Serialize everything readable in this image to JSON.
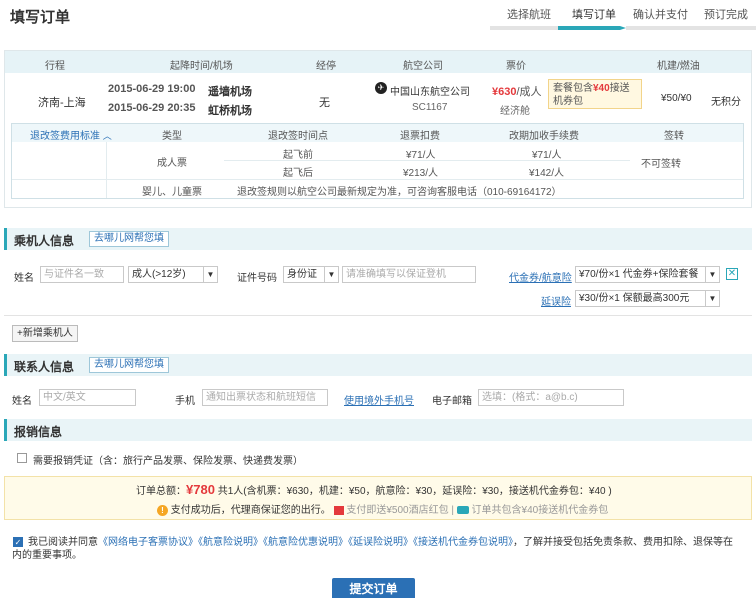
{
  "page_title": "填写订单",
  "steps": [
    {
      "label": "选择航班"
    },
    {
      "label": "填写订单"
    },
    {
      "label": "确认并支付"
    },
    {
      "label": "预订完成"
    }
  ],
  "flight_table": {
    "headers": {
      "route": "行程",
      "time_airport": "起降时间/机场",
      "stops": "经停",
      "airline": "航空公司",
      "price": "票价",
      "tax": "机建/燃油"
    },
    "route": "济南-上海",
    "dep_datetime": "2015-06-29  19:00",
    "dep_airport": "遥墙机场",
    "arr_datetime": "2015-06-29  20:35",
    "arr_airport": "虹桥机场",
    "stops": "无",
    "airline_name": "中国山东航空公司",
    "flight_no": "SC1167",
    "price": "¥630",
    "price_unit": "/成人",
    "cabin": "经济舱",
    "package_pre": "套餐包含",
    "package_amount": "¥40",
    "package_post": "接送机券包",
    "tax": "¥50/¥0",
    "points": "无积分",
    "airline_icon": "airline-logo-icon"
  },
  "rules": {
    "toggle_label": "退改签费用标准",
    "toggle_icon": "chevron-up-icon",
    "headers": {
      "type": "类型",
      "time": "退改签时间点",
      "refund": "退票扣费",
      "change": "改期加收手续费",
      "endorse": "签转"
    },
    "adult_label": "成人票",
    "rows": [
      {
        "time": "起飞前",
        "refund": "¥71/人",
        "change": "¥71/人"
      },
      {
        "time": "起飞后",
        "refund": "¥213/人",
        "change": "¥142/人"
      }
    ],
    "endorse_value": "不可签转",
    "child_label": "婴儿、儿童票",
    "child_note": "退改签规则以航空公司最新规定为准，可咨询客服电话（010-69164172）"
  },
  "passenger": {
    "title": "乘机人信息",
    "help": "去哪儿网帮您填",
    "name_label": "姓名",
    "name_placeholder": "与证件名一致",
    "type_value": "成人(>12岁)",
    "id_label": "证件号码",
    "id_type": "身份证",
    "id_placeholder": "请准确填写以保证登机",
    "insurance_link1": "代金券/航意险",
    "insurance_value1": "¥70/份×1 代金券+保险套餐",
    "insurance_link2": "延误险",
    "insurance_value2": "¥30/份×1 保额最高300元",
    "add_label": "+新增乘机人"
  },
  "contact": {
    "title": "联系人信息",
    "help": "去哪儿网帮您填",
    "name_label": "姓名",
    "name_placeholder": "中文/英文",
    "phone_label": "手机",
    "phone_placeholder": "通知出票状态和航班短信",
    "foreign_link": "使用境外手机号",
    "email_label": "电子邮箱",
    "email_placeholder": "选填：(格式：a@b.c)"
  },
  "reimburse": {
    "title": "报销信息",
    "checkbox_label": "需要报销凭证（含：旅行产品发票、保险发票、快递费发票）"
  },
  "summary": {
    "total_label": "订单总额：",
    "total_amount": "¥780",
    "total_detail": "共1人(含机票：¥630，机建：¥50，航意险：¥30，延误险：¥30，接送机代金券包：¥40 )",
    "notice": "支付成功后，代理商保证您的出行。",
    "gift_text": "支付即送¥500酒店红包",
    "car_text": "订单共包含¥40接送机代金券包"
  },
  "agreement": {
    "prefix": "我已阅读并同意",
    "links": [
      "《网络电子客票协议》",
      "《航意险说明》",
      "《航意险优惠说明》",
      "《延误险说明》",
      "《接送机代金券包说明》"
    ],
    "suffix": "，了解并接受包括免责条款、费用扣除、退保等在内的重要事项。"
  },
  "submit_label": "提交订单",
  "colors": {
    "accent": "#2aa7b8",
    "link": "#2b70b5",
    "price": "#e4393c"
  }
}
